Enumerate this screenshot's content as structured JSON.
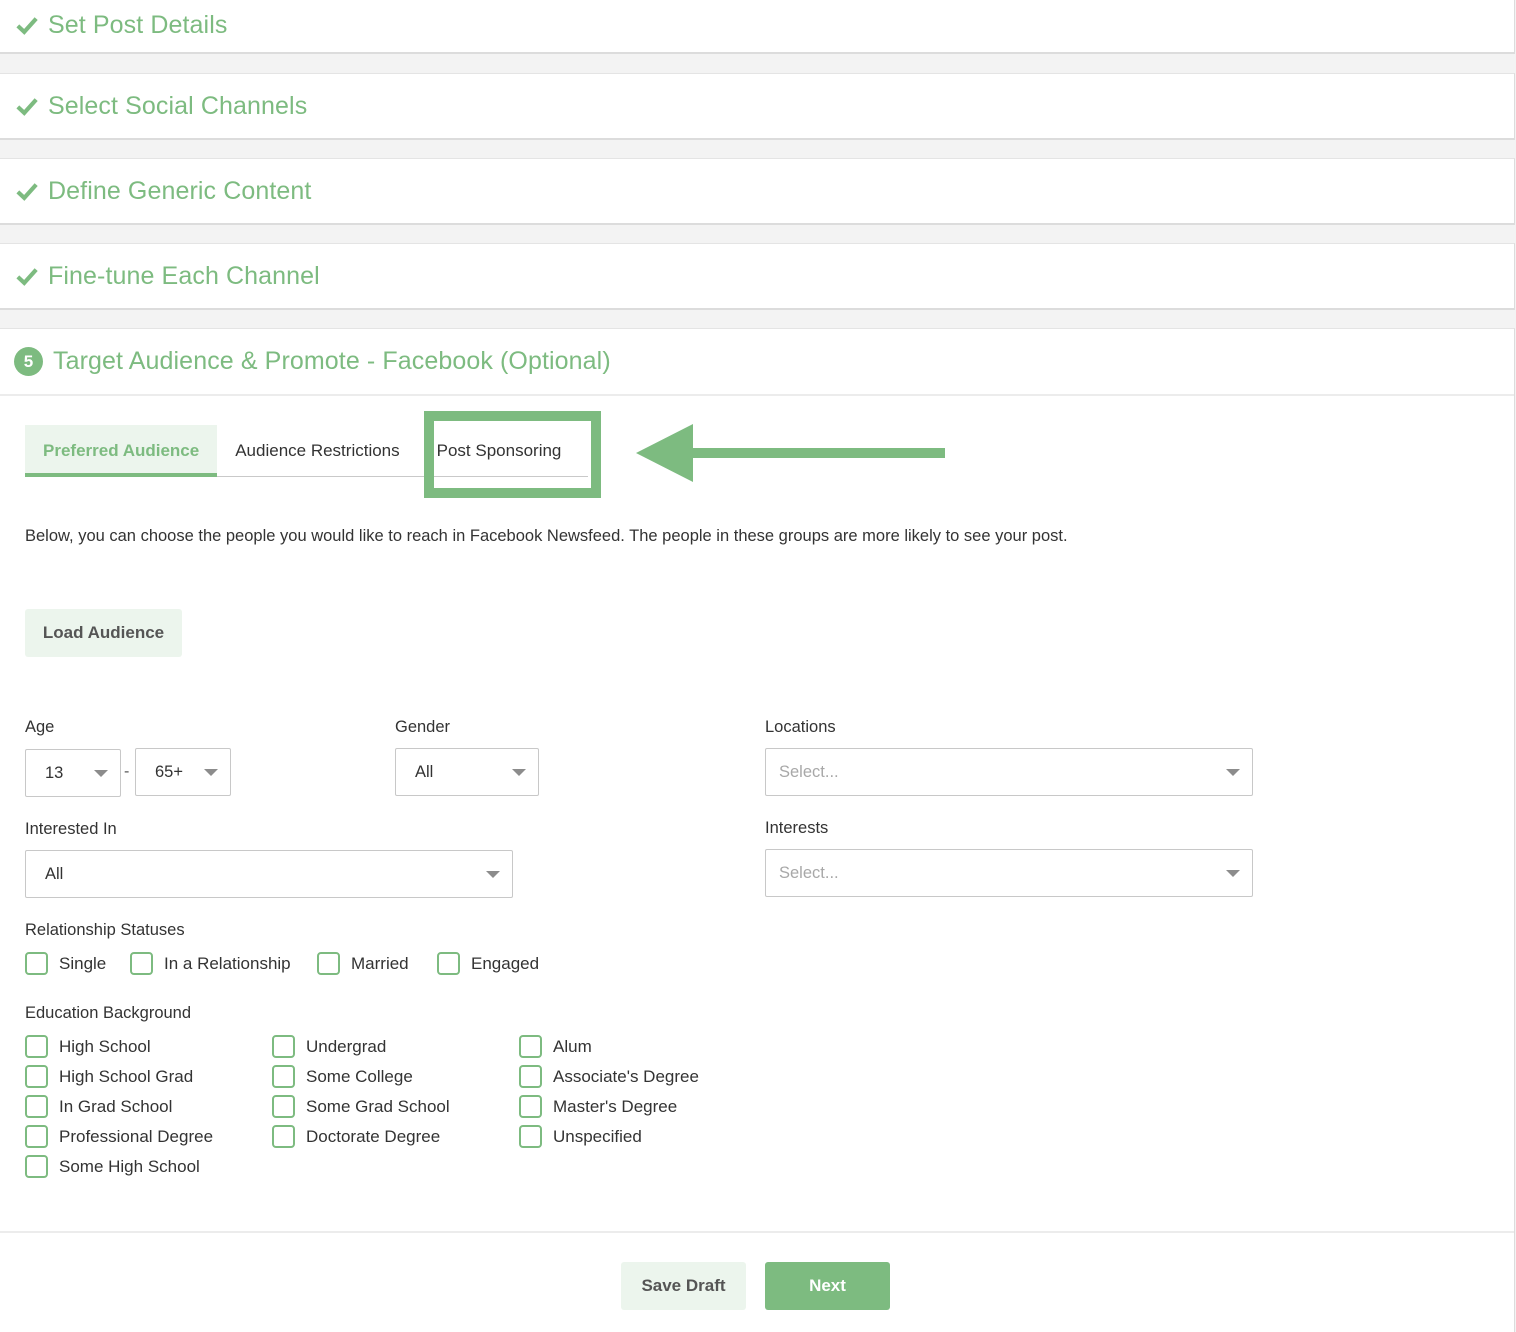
{
  "colors": {
    "accent": "#7dbb80",
    "accent_light": "#ecf5ed",
    "text": "#333333",
    "placeholder": "#a8a8a8"
  },
  "steps": [
    {
      "title": "Set Post Details",
      "status": "complete",
      "icon": "check-icon"
    },
    {
      "title": "Select Social Channels",
      "status": "complete",
      "icon": "check-icon"
    },
    {
      "title": "Define Generic Content",
      "status": "complete",
      "icon": "check-icon"
    },
    {
      "title": "Fine-tune Each Channel",
      "status": "complete",
      "icon": "check-icon"
    }
  ],
  "active_step": {
    "number": "5",
    "title": "Target Audience & Promote - Facebook (Optional)"
  },
  "tabs": [
    {
      "label": "Preferred Audience",
      "active": true
    },
    {
      "label": "Audience Restrictions",
      "active": false
    },
    {
      "label": "Post Sponsoring",
      "active": false,
      "highlighted": true
    }
  ],
  "annotation": {
    "arrow_icon": "arrow-left-icon",
    "points_to": "Post Sponsoring"
  },
  "intro_text": "Below, you can choose the people you would like to reach in Facebook Newsfeed. The people in these groups are more likely to see your post.",
  "load_audience_label": "Load Audience",
  "fields": {
    "age": {
      "label": "Age",
      "min": "13",
      "separator": "-",
      "max": "65+"
    },
    "gender": {
      "label": "Gender",
      "value": "All"
    },
    "locations": {
      "label": "Locations",
      "placeholder": "Select..."
    },
    "interested_in": {
      "label": "Interested In",
      "value": "All"
    },
    "interests": {
      "label": "Interests",
      "placeholder": "Select..."
    }
  },
  "relationship": {
    "label": "Relationship Statuses",
    "options": [
      {
        "label": "Single",
        "checked": false
      },
      {
        "label": "In a Relationship",
        "checked": false
      },
      {
        "label": "Married",
        "checked": false
      },
      {
        "label": "Engaged",
        "checked": false
      }
    ]
  },
  "education": {
    "label": "Education Background",
    "columns": [
      [
        {
          "label": "High School",
          "checked": false
        },
        {
          "label": "High School Grad",
          "checked": false
        },
        {
          "label": "In Grad School",
          "checked": false
        },
        {
          "label": "Professional Degree",
          "checked": false
        },
        {
          "label": "Some High School",
          "checked": false
        }
      ],
      [
        {
          "label": "Undergrad",
          "checked": false
        },
        {
          "label": "Some College",
          "checked": false
        },
        {
          "label": "Some Grad School",
          "checked": false
        },
        {
          "label": "Doctorate Degree",
          "checked": false
        }
      ],
      [
        {
          "label": "Alum",
          "checked": false
        },
        {
          "label": "Associate's Degree",
          "checked": false
        },
        {
          "label": "Master's Degree",
          "checked": false
        },
        {
          "label": "Unspecified",
          "checked": false
        }
      ]
    ]
  },
  "footer": {
    "save_draft_label": "Save Draft",
    "next_label": "Next"
  }
}
